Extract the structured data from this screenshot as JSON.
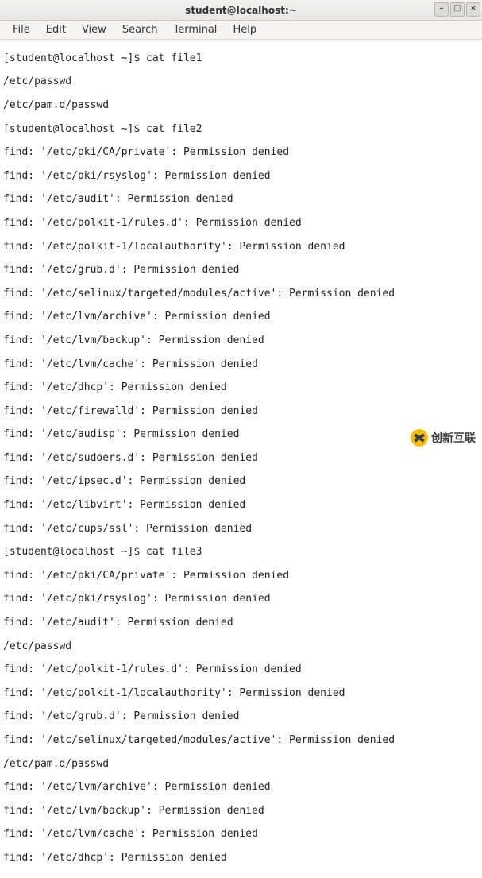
{
  "titlebar": {
    "title": "student@localhost:~"
  },
  "window_controls": {
    "minimize": "–",
    "maximize": "□",
    "close": "×"
  },
  "menubar": {
    "file": "File",
    "edit": "Edit",
    "view": "View",
    "search": "Search",
    "terminal": "Terminal",
    "help": "Help"
  },
  "terminal": {
    "prompt": "[student@localhost ~]$",
    "cmd1": "cat file1",
    "out1": [
      "/etc/passwd",
      "/etc/pam.d/passwd"
    ],
    "cmd2": "cat file2",
    "out2": [
      "find: '/etc/pki/CA/private': Permission denied",
      "find: '/etc/pki/rsyslog': Permission denied",
      "find: '/etc/audit': Permission denied",
      "find: '/etc/polkit-1/rules.d': Permission denied",
      "find: '/etc/polkit-1/localauthority': Permission denied",
      "find: '/etc/grub.d': Permission denied",
      "find: '/etc/selinux/targeted/modules/active': Permission denied",
      "find: '/etc/lvm/archive': Permission denied",
      "find: '/etc/lvm/backup': Permission denied",
      "find: '/etc/lvm/cache': Permission denied",
      "find: '/etc/dhcp': Permission denied",
      "find: '/etc/firewalld': Permission denied",
      "find: '/etc/audisp': Permission denied",
      "find: '/etc/sudoers.d': Permission denied",
      "find: '/etc/ipsec.d': Permission denied",
      "find: '/etc/libvirt': Permission denied",
      "find: '/etc/cups/ssl': Permission denied"
    ],
    "cmd3": "cat file3",
    "out3": [
      "find: '/etc/pki/CA/private': Permission denied",
      "find: '/etc/pki/rsyslog': Permission denied",
      "find: '/etc/audit': Permission denied",
      "/etc/passwd",
      "find: '/etc/polkit-1/rules.d': Permission denied",
      "find: '/etc/polkit-1/localauthority': Permission denied",
      "find: '/etc/grub.d': Permission denied",
      "find: '/etc/selinux/targeted/modules/active': Permission denied",
      "/etc/pam.d/passwd",
      "find: '/etc/lvm/archive': Permission denied",
      "find: '/etc/lvm/backup': Permission denied",
      "find: '/etc/lvm/cache': Permission denied",
      "find: '/etc/dhcp': Permission denied"
    ]
  },
  "watermark": {
    "text": "创新互联"
  }
}
